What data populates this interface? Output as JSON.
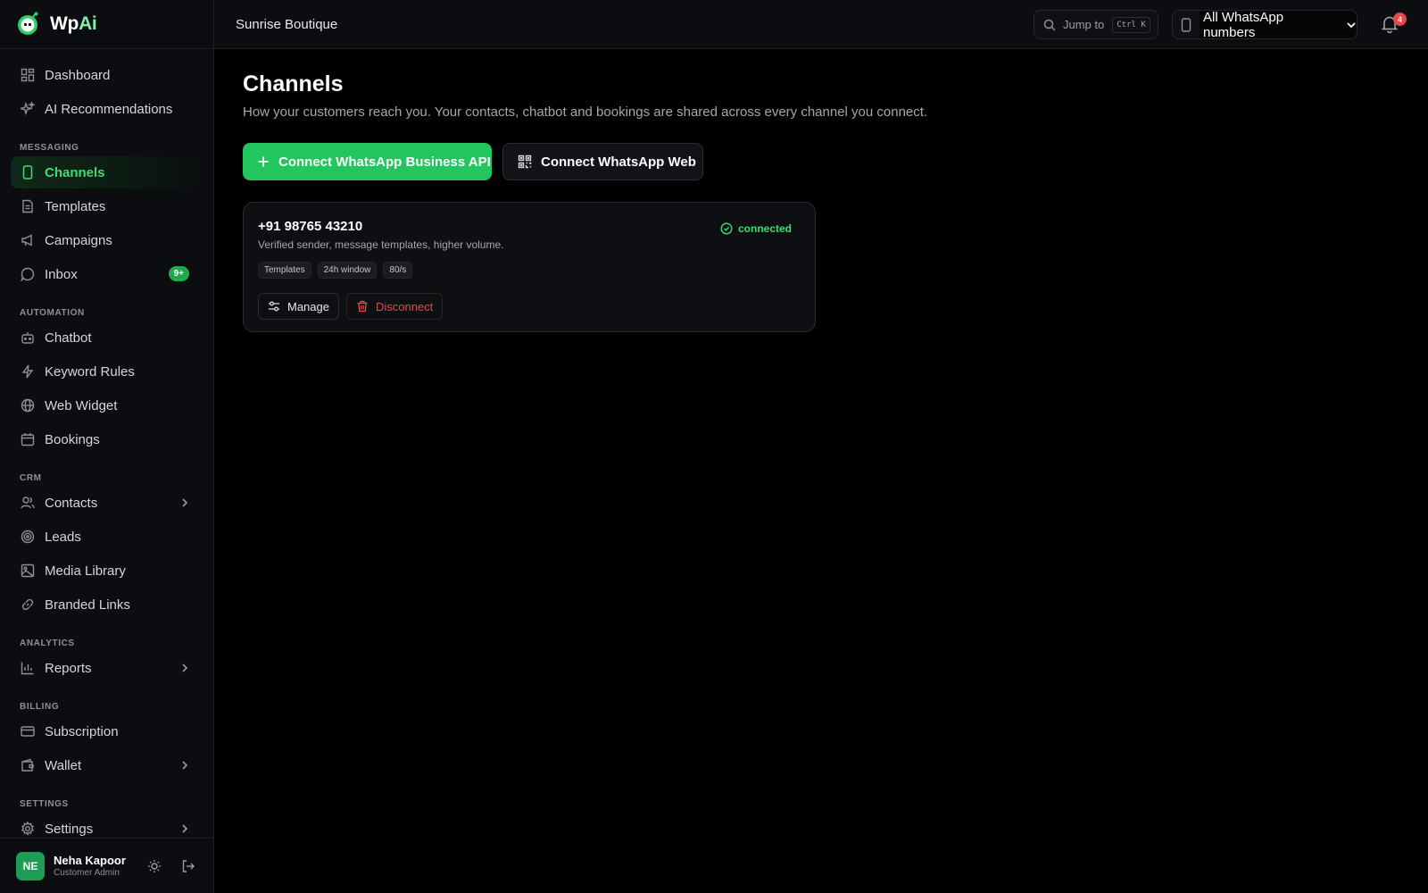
{
  "brand": {
    "name_main": "Wp",
    "name_accent": "Ai"
  },
  "topbar": {
    "org_name": "Sunrise Boutique",
    "jump_label": "Jump to",
    "jump_shortcut": "Ctrl K",
    "number_select_value": "All WhatsApp numbers",
    "notification_count": "4"
  },
  "sidebar": {
    "dashboard": "Dashboard",
    "ai_recommendations": "AI Recommendations",
    "section_messaging": "MESSAGING",
    "channels": "Channels",
    "templates": "Templates",
    "campaigns": "Campaigns",
    "inbox": "Inbox",
    "inbox_badge": "9+",
    "section_automation": "AUTOMATION",
    "chatbot": "Chatbot",
    "keyword_rules": "Keyword Rules",
    "web_widget": "Web Widget",
    "bookings": "Bookings",
    "section_crm": "CRM",
    "contacts": "Contacts",
    "leads": "Leads",
    "media_library": "Media Library",
    "branded_links": "Branded Links",
    "section_analytics": "ANALYTICS",
    "reports": "Reports",
    "section_billing": "BILLING",
    "subscription": "Subscription",
    "wallet": "Wallet",
    "section_settings": "SETTINGS",
    "settings": "Settings"
  },
  "user": {
    "initials": "NE",
    "name": "Neha Kapoor",
    "role": "Customer Admin"
  },
  "main": {
    "title": "Channels",
    "subtitle": "How your customers reach you. Your contacts, chatbot and bookings are shared across every channel you connect.",
    "connect_api_label": "Connect WhatsApp Business API",
    "connect_web_label": "Connect WhatsApp Web"
  },
  "channel_card": {
    "number": "+91 98765 43210",
    "description": "Verified sender, message templates, higher volume.",
    "status": "connected",
    "tags": [
      "Templates",
      "24h window",
      "80/s"
    ],
    "manage_label": "Manage",
    "disconnect_label": "Disconnect"
  },
  "colors": {
    "accent": "#22c55e",
    "active_text": "#3fdc73",
    "danger": "#e5484d",
    "background": "#000000"
  }
}
